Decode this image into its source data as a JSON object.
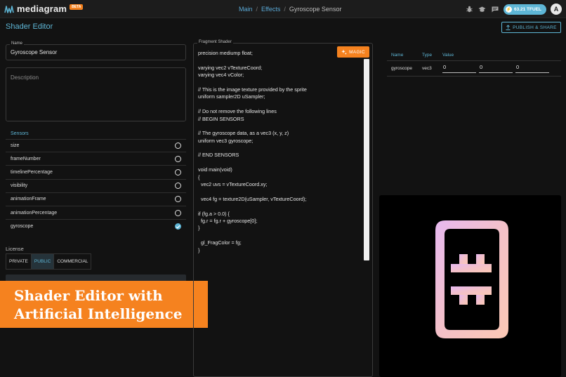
{
  "app": {
    "name": "mediagram",
    "badge": "BETA"
  },
  "breadcrumb": [
    {
      "label": "Main"
    },
    {
      "label": "Effects"
    },
    {
      "label": "Gyroscope Sensor"
    }
  ],
  "header": {
    "fuel_label": "63.21 TFUEL",
    "avatar_initial": "A"
  },
  "page": {
    "title": "Shader Editor",
    "publish_label": "PUBLISH & SHARE"
  },
  "form": {
    "name_label": "Name",
    "name_value": "Gyroscope Sensor",
    "description_placeholder": "Description"
  },
  "sensors": {
    "title": "Sensors",
    "items": [
      {
        "label": "size",
        "checked": false
      },
      {
        "label": "frameNumber",
        "checked": false
      },
      {
        "label": "timelinePercentage",
        "checked": false
      },
      {
        "label": "visibility",
        "checked": false
      },
      {
        "label": "animationFrame",
        "checked": false
      },
      {
        "label": "animationPercentage",
        "checked": false
      },
      {
        "label": "gyroscope",
        "checked": true
      }
    ]
  },
  "license": {
    "title": "License",
    "options": [
      {
        "label": "PRIVATE",
        "active": false
      },
      {
        "label": "PUBLIC",
        "active": true
      },
      {
        "label": "COMMERCIAL",
        "active": false
      }
    ]
  },
  "banner": {
    "line1": "Shader Editor with",
    "line2": "Artificial Intelligence"
  },
  "editor": {
    "label": "Fragment Shader",
    "magic_label": "MAGIC",
    "code": [
      "precision mediump float;",
      "",
      "varying vec2 vTextureCoord;",
      "varying vec4 vColor;",
      "",
      "// This is the image texture provided by the sprite",
      "uniform sampler2D uSampler;",
      "",
      "// Do not remove the following lines",
      "// BEGIN SENSORS",
      "",
      "// The gyroscope data, as a vec3 (x, y, z)",
      "uniform vec3 gyroscope;",
      "",
      "// END SENSORS",
      "",
      "void main(void)",
      "{",
      "  vec2 uvs = vTextureCoord.xy;",
      "",
      "  vec4 fg = texture2D(uSampler, vTextureCoord);",
      "",
      "if (fg.a > 0.0) {",
      "  fg.r = fg.r + gyroscope[0];",
      "}",
      "",
      "  gl_FragColor = fg;",
      "}"
    ]
  },
  "uniforms": {
    "headers": {
      "name": "Name",
      "type": "Type",
      "value": "Value"
    },
    "rows": [
      {
        "name": "gyroscope",
        "type": "vec3",
        "values": [
          "0",
          "0",
          "0"
        ]
      }
    ]
  },
  "colors": {
    "accent": "#5eb6d6",
    "orange": "#f5821f",
    "background": "#121212"
  },
  "icons": [
    "logo-wave-icon",
    "bug-icon",
    "graduation-cap-icon",
    "chat-icon",
    "tfuel-icon",
    "upload-icon",
    "sparkle-icon",
    "check-icon"
  ]
}
